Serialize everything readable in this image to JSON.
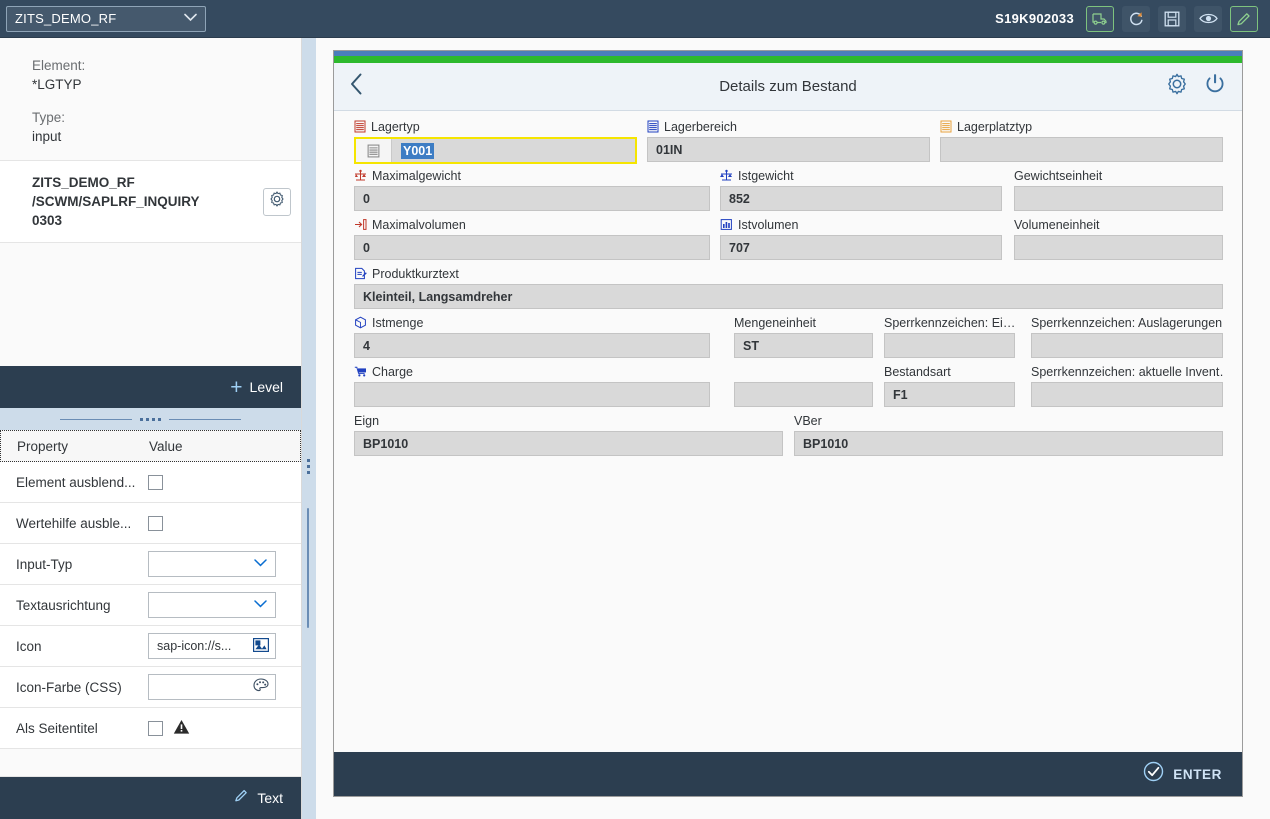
{
  "topbar": {
    "project_select": "ZITS_DEMO_RF",
    "chevron": "⌄",
    "system_id": "S19K902033",
    "buttons": [
      {
        "name": "transport-button",
        "icon": "truck-icon",
        "highlight": true
      },
      {
        "name": "refresh-button",
        "icon": "refresh-icon",
        "highlight": false
      },
      {
        "name": "save-button",
        "icon": "save-icon",
        "highlight": false
      },
      {
        "name": "preview-button",
        "icon": "eye-icon",
        "highlight": false
      },
      {
        "name": "edit-button",
        "icon": "pencil-icon",
        "highlight": true
      }
    ]
  },
  "sidebar": {
    "element_label": "Element:",
    "element_value": "*LGTYP",
    "type_label": "Type:",
    "type_value": "input",
    "card_line1": "ZITS_DEMO_RF",
    "card_line2": "/SCWM/SAPLRF_INQUIRY",
    "card_line3": "0303",
    "level_button": "Level",
    "level_plus": "+",
    "text_button": "Text",
    "table": {
      "header": {
        "property": "Property",
        "value": "Value"
      },
      "rows": [
        {
          "property": "Element ausblend...",
          "control": "checkbox",
          "value": "",
          "checked": false,
          "warning": false
        },
        {
          "property": "Wertehilfe ausble...",
          "control": "checkbox",
          "value": "",
          "checked": false,
          "warning": false
        },
        {
          "property": "Input-Typ",
          "control": "select",
          "value": "",
          "checked": false,
          "warning": false
        },
        {
          "property": "Textausrichtung",
          "control": "select",
          "value": "",
          "checked": false,
          "warning": false
        },
        {
          "property": "Icon",
          "control": "text-icon",
          "value": "sap-icon://s...",
          "checked": false,
          "warning": false
        },
        {
          "property": "Icon-Farbe (CSS)",
          "control": "text-color",
          "value": "",
          "checked": false,
          "warning": false
        },
        {
          "property": "Als Seitentitel",
          "control": "checkbox",
          "value": "",
          "checked": false,
          "warning": true
        }
      ]
    }
  },
  "device": {
    "title": "Details zum Bestand",
    "back_icon": "chevron-left-icon",
    "settings_icon": "gear-icon",
    "power_icon": "power-icon",
    "footer_button": "ENTER",
    "fields": [
      {
        "label": "Lagertyp",
        "value": "Y001",
        "icon": "rack-icon",
        "icon_color": "#c0392b",
        "focused": true,
        "selected": true
      },
      {
        "label": "Lagerbereich",
        "value": "01IN",
        "icon": "rack-icon",
        "icon_color": "#2040c0",
        "focused": false,
        "selected": false
      },
      {
        "label": "Lagerplatztyp",
        "value": "",
        "icon": "rack-icon",
        "icon_color": "#e8a33d",
        "focused": false,
        "selected": false
      },
      {
        "label": "Maximalgewicht",
        "value": "0",
        "icon": "scale-icon",
        "icon_color": "#c0392b",
        "focused": false,
        "selected": false
      },
      {
        "label": "Istgewicht",
        "value": "852",
        "icon": "scale-icon",
        "icon_color": "#2040c0",
        "focused": false,
        "selected": false
      },
      {
        "label": "Gewichtseinheit",
        "value": "",
        "icon": "",
        "icon_color": "",
        "focused": false,
        "selected": false
      },
      {
        "label": "Maximalvolumen",
        "value": "0",
        "icon": "volume-icon",
        "icon_color": "#c0392b",
        "focused": false,
        "selected": false
      },
      {
        "label": "Istvolumen",
        "value": "707",
        "icon": "volume-icon",
        "icon_color": "#2040c0",
        "focused": false,
        "selected": false
      },
      {
        "label": "Volumeneinheit",
        "value": "",
        "icon": "",
        "icon_color": "",
        "focused": false,
        "selected": false
      },
      {
        "label": "Produktkurztext",
        "value": "Kleinteil, Langsamdreher",
        "icon": "note-icon",
        "icon_color": "#2040c0",
        "focused": false,
        "selected": false
      },
      {
        "label": "Istmenge",
        "value": "4",
        "icon": "box-icon",
        "icon_color": "#2040c0",
        "focused": false,
        "selected": false
      },
      {
        "label": "Mengeneinheit",
        "value": "ST",
        "icon": "",
        "icon_color": "",
        "focused": false,
        "selected": false
      },
      {
        "label": "Sperrkennzeichen: Ei…",
        "value": "",
        "icon": "",
        "icon_color": "",
        "focused": false,
        "selected": false
      },
      {
        "label": "Sperrkennzeichen: Auslagerungen",
        "value": "",
        "icon": "",
        "icon_color": "",
        "focused": false,
        "selected": false
      },
      {
        "label": "Charge",
        "value": "",
        "icon": "cart-icon",
        "icon_color": "#2040c0",
        "focused": false,
        "selected": false
      },
      {
        "label": "",
        "value": "",
        "icon": "",
        "icon_color": "",
        "focused": false,
        "selected": false
      },
      {
        "label": "Bestandsart",
        "value": "F1",
        "icon": "",
        "icon_color": "",
        "focused": false,
        "selected": false
      },
      {
        "label": "Sperrkennzeichen: aktuelle Invent…",
        "value": "",
        "icon": "",
        "icon_color": "",
        "focused": false,
        "selected": false
      },
      {
        "label": "Eign",
        "value": "BP1010",
        "icon": "",
        "icon_color": "",
        "focused": false,
        "selected": false
      },
      {
        "label": "VBer",
        "value": "BP1010",
        "icon": "",
        "icon_color": "",
        "focused": false,
        "selected": false
      }
    ]
  },
  "colors": {
    "shell": "#354a5f",
    "dark_bar": "#2c3e50",
    "accent_green": "#2db92d",
    "accent_blue": "#4a7ebb",
    "focus_yellow": "#f5e500",
    "selection_blue": "#3d7dc4",
    "field_bg": "#d9d9d9",
    "gutter": "#cddcea"
  }
}
